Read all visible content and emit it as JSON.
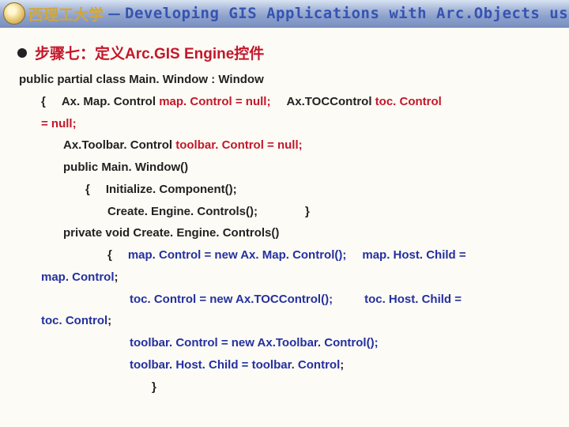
{
  "header": {
    "university": "西理工大学",
    "dash": "－",
    "title": "Developing GIS Applications with Arc.Objects using C#. NE"
  },
  "heading": "步骤七：定义Arc.GIS Engine控件",
  "code": {
    "l1_a": "public partial class Main. Window : Window",
    "l2_a": "{",
    "l2_b": "Ax. Map. Control",
    "l2_c": "map. Control = null;",
    "l2_d": "Ax.TOCControl",
    "l2_e": "toc. Control",
    "l2_f": "= null;",
    "l3_a": "Ax.Toolbar. Control",
    "l3_b": "toolbar. Control = null;",
    "l4_a": "public Main. Window()",
    "l5_a": "{",
    "l5_b": "Initialize. Component();",
    "l6_a": "Create. Engine. Controls();",
    "l6_b": "}",
    "l7_a": "private void Create. Engine. Controls()",
    "l8_a": "{",
    "l8_b": "map. Control = new Ax. Map. Control();",
    "l8_c": "map. Host. Child =",
    "l8_d": "map. Control",
    "l8_e": ";",
    "l9_a": "toc. Control = new Ax.TOCControl();",
    "l9_b": "toc. Host. Child =",
    "l9_c": "toc. Control",
    "l9_d": ";",
    "l10_a": "toolbar. Control = new Ax.Toolbar. Control();",
    "l11_a": "toolbar. Host. Child = toolbar. Control",
    "l11_b": ";",
    "l12_a": "}"
  }
}
